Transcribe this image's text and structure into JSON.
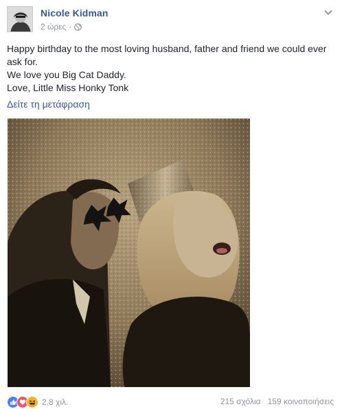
{
  "post": {
    "author": "Nicole Kidman",
    "time": "2 ώρες",
    "separator": "·",
    "lines": [
      "Happy birthday to the most loving husband, father and friend we could ever ask for.",
      "We love you Big Cat Daddy.",
      "Love, Little Miss Honky Tonk"
    ],
    "translate_link": "Δείτε τη μετάφραση"
  },
  "footer": {
    "reactions_count": "2,8 χιλ.",
    "comments": "215 σχόλια",
    "shares": "159 κοινοποιήσεις"
  },
  "icons": {
    "privacy": "globe-icon",
    "menu": "chevron-down-icon",
    "reactions": [
      "like-icon",
      "love-icon",
      "haha-icon"
    ]
  },
  "colors": {
    "link": "#365899",
    "text": "#1d2129",
    "meta": "#90949c",
    "like": "#4080ff",
    "love": "#f25268",
    "haha": "#f7b125"
  }
}
